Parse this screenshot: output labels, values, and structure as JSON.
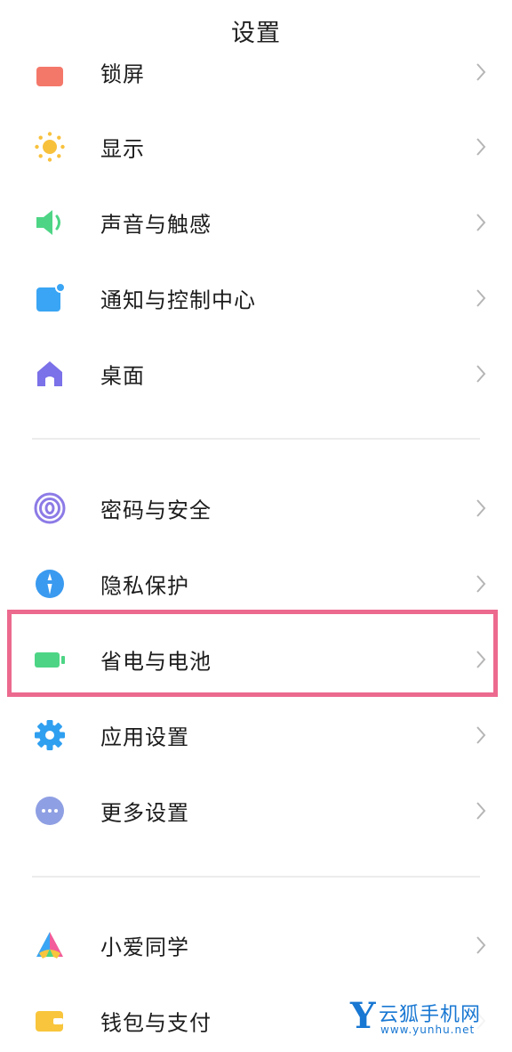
{
  "header": {
    "title": "设置"
  },
  "section1": [
    {
      "label": "锁屏",
      "icon": "lock-screen-icon"
    },
    {
      "label": "显示",
      "icon": "sun-icon"
    },
    {
      "label": "声音与触感",
      "icon": "speaker-icon"
    },
    {
      "label": "通知与控制中心",
      "icon": "notification-icon"
    },
    {
      "label": "桌面",
      "icon": "home-icon"
    }
  ],
  "section2": [
    {
      "label": "密码与安全",
      "icon": "fingerprint-icon"
    },
    {
      "label": "隐私保护",
      "icon": "privacy-shield-icon"
    },
    {
      "label": "省电与电池",
      "icon": "battery-icon",
      "highlighted": true
    },
    {
      "label": "应用设置",
      "icon": "gear-icon"
    },
    {
      "label": "更多设置",
      "icon": "more-icon"
    }
  ],
  "section3": [
    {
      "label": "小爱同学",
      "icon": "xiaoai-icon"
    },
    {
      "label": "钱包与支付",
      "icon": "wallet-icon"
    }
  ],
  "watermark": {
    "logo": "Y",
    "name": "云狐手机网",
    "url": "www.yunhu.net"
  },
  "colors": {
    "lock": "#f4786a",
    "sun": "#f8c13c",
    "speaker": "#4dd585",
    "notification": "#3aa5f4",
    "home": "#7b71e8",
    "fingerprint": "#8c7be6",
    "privacy": "#3a9af0",
    "battery": "#4dd585",
    "gear": "#2f9ff0",
    "more": "#8f9fe3",
    "wallet": "#f8c53c",
    "highlight": "#ec6a8e"
  }
}
